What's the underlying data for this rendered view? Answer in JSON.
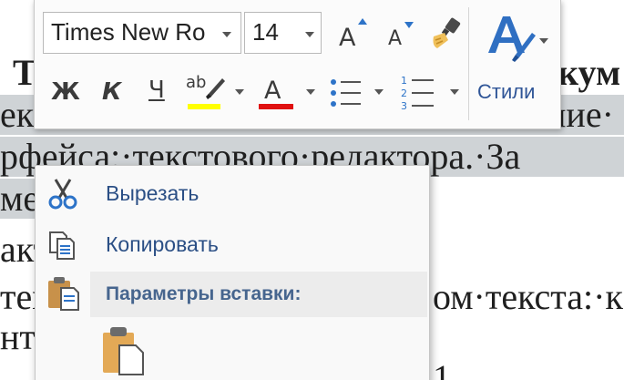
{
  "document": {
    "lines": [
      {
        "text": "Т",
        "tail": "кум"
      },
      {
        "text": "ект",
        "tail": "ние·"
      },
      {
        "text": "рфейса:·текстового·редактора.·За"
      },
      {
        "text": "мен"
      },
      {
        "text": "акт"
      },
      {
        "text": "тек",
        "tail": "ом·текста:·к"
      },
      {
        "text": "нт"
      },
      {
        "text": "",
        "tail": "1"
      }
    ]
  },
  "mini_toolbar": {
    "font_name": "Times New Roi",
    "font_size": "14",
    "grow_font_label": "A",
    "shrink_font_label": "A",
    "bold_label": "Ж",
    "italic_label": "К",
    "underline_label": "Ч",
    "highlight_label": "ab",
    "font_color_label": "A",
    "styles_label": "Стили",
    "highlight_color": "#ffff00",
    "font_color": "#e01010",
    "icons": [
      "format-painter-icon",
      "bullets-icon",
      "numbering-icon",
      "styles-icon"
    ]
  },
  "context_menu": {
    "items": [
      {
        "label": "Вырезать",
        "icon": "scissors-icon"
      },
      {
        "label": "Копировать",
        "icon": "copy-icon"
      }
    ],
    "paste_header": {
      "label": "Параметры вставки:",
      "icon": "paste-header-icon"
    },
    "paste_option_icon": "paste-keep-formatting-icon"
  }
}
